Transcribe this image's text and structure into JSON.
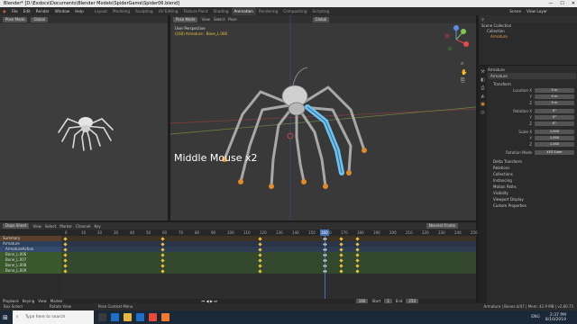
{
  "window": {
    "title": "Blender* [D:\\Exdocs\\Documents\\Blender Models\\SpiderGame\\Spider06.blend]",
    "minimize": "—",
    "maximize": "☐",
    "close": "✕"
  },
  "menubar": {
    "items": [
      "File",
      "Edit",
      "Render",
      "Window",
      "Help"
    ],
    "workspaces": [
      "Layout",
      "Modeling",
      "Sculpting",
      "UV Editing",
      "Texture Paint",
      "Shading",
      "Animation",
      "Rendering",
      "Compositing",
      "Scripting"
    ],
    "active_workspace": "Animation",
    "scene": "Scene",
    "view_layer": "View Layer"
  },
  "left_viewport": {
    "mode": "Pose Mode",
    "transform": "Global"
  },
  "main_viewport": {
    "mode": "Pose Mode",
    "menus": [
      "View",
      "Select",
      "Pose"
    ],
    "transform": "Global",
    "perspective": "User Perspective",
    "info": "(160) Armature : Bone_L.006",
    "overlay_caption": "Middle Mouse x2"
  },
  "outliner": {
    "title": "Scene Collection",
    "items": [
      "Collection",
      "Armature"
    ]
  },
  "properties": {
    "object_name": "Armature",
    "name_field": "Armature",
    "transform_title": "Transform",
    "location_label": "Location X",
    "rotation_label": "Rotation X",
    "scale_label": "Scale X",
    "axes": [
      "Y",
      "Z"
    ],
    "location": [
      "0 m",
      "0 m",
      "0 m"
    ],
    "rotation": [
      "0°",
      "0°",
      "0°"
    ],
    "scale": [
      "1.000",
      "1.000",
      "1.000"
    ],
    "rotation_mode_label": "Rotation Mode",
    "rotation_mode": "XYZ Euler",
    "sections": [
      "Delta Transform",
      "Relations",
      "Collections",
      "Instancing",
      "Motion Paths",
      "Visibility",
      "Viewport Display",
      "Custom Properties"
    ]
  },
  "dopesheet": {
    "editor": "Dope Sheet",
    "menus": [
      "View",
      "Select",
      "Marker",
      "Channel",
      "Key"
    ],
    "interp": "Nearest Frame",
    "ruler": [
      "0",
      "10",
      "20",
      "30",
      "40",
      "50",
      "60",
      "70",
      "80",
      "90",
      "100",
      "110",
      "120",
      "130",
      "140",
      "150",
      "160",
      "170",
      "180",
      "190",
      "200",
      "210",
      "220",
      "230",
      "240",
      "250"
    ],
    "current_frame": "160",
    "channels": [
      "Summary",
      "Armature",
      "ArmatureAction",
      "Bone_L.006",
      "Bone_L.007",
      "Bone_L.008",
      "Bone_L.009"
    ],
    "key_frames": [
      0,
      60,
      120,
      160,
      170,
      180
    ]
  },
  "timeline": {
    "menus": [
      "Playback",
      "Keying",
      "View",
      "Marker"
    ],
    "frame": "160",
    "start_label": "Start",
    "start": "1",
    "end_label": "End",
    "end": "250"
  },
  "status": {
    "left": "Box Select",
    "middle": "Rotate View",
    "right": "Pose Context Menu",
    "stats": "Armature | Bones:4/47 | Mem: 42.9 MB | v2.80.75"
  },
  "taskbar": {
    "search_placeholder": "Type here to search",
    "time": "2:37 PM",
    "date": "8/10/2019",
    "lang": "ENG"
  },
  "colors": {
    "accent": "#4772b3",
    "bone_selected": "#6ec3f0",
    "keyframe": "#e8c43a"
  }
}
